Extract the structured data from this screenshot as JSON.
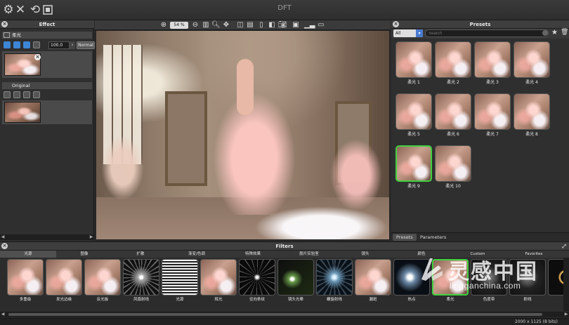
{
  "window": {
    "title": "DFT"
  },
  "toolbar": {
    "icons": [
      "gear-icon",
      "close-x-icon",
      "refresh-icon",
      "fit-screen-icon"
    ]
  },
  "effect_panel": {
    "title": "Effect",
    "layer_section": {
      "name": "柔光",
      "opacity_value": "100.0",
      "blend_mode": "Normal"
    },
    "original_section": {
      "name": "Original"
    }
  },
  "canvas": {
    "zoom_value": "54 %"
  },
  "presets_panel": {
    "title": "Presets",
    "category": "All",
    "search_placeholder": "Search",
    "items": [
      {
        "label": "柔光 1",
        "selected": false
      },
      {
        "label": "柔光 2",
        "selected": false
      },
      {
        "label": "柔光 3",
        "selected": false
      },
      {
        "label": "柔光 4",
        "selected": false
      },
      {
        "label": "柔光 5",
        "selected": false
      },
      {
        "label": "柔光 6",
        "selected": false
      },
      {
        "label": "柔光 7",
        "selected": false
      },
      {
        "label": "柔光 8",
        "selected": false
      },
      {
        "label": "柔光 9",
        "selected": true
      },
      {
        "label": "柔光 10",
        "selected": false
      }
    ],
    "tabs": [
      {
        "label": "Presets",
        "active": true
      },
      {
        "label": "Parameters",
        "active": false
      }
    ]
  },
  "filters_panel": {
    "title": "Filters",
    "categories": [
      {
        "label": "光源",
        "active": true
      },
      {
        "label": "图像",
        "active": false
      },
      {
        "label": "扩散",
        "active": false
      },
      {
        "label": "渐变/色调",
        "active": false
      },
      {
        "label": "特殊效果",
        "active": false
      },
      {
        "label": "胶片实验室",
        "active": false
      },
      {
        "label": "镜头",
        "active": false
      },
      {
        "label": "颜色",
        "active": false
      },
      {
        "label": "Custom",
        "active": false
      },
      {
        "label": "Favorites",
        "active": false
      }
    ],
    "items": [
      {
        "label": "多重级",
        "style": "photo"
      },
      {
        "label": "发光边缘",
        "style": "photo"
      },
      {
        "label": "反光板",
        "style": "photo"
      },
      {
        "label": "风扇射线",
        "style": "burst"
      },
      {
        "label": "光源",
        "style": "lines"
      },
      {
        "label": "辉光",
        "style": "photo"
      },
      {
        "label": "径向条纹",
        "style": "radial"
      },
      {
        "label": "镜头光晕",
        "style": "flare"
      },
      {
        "label": "螺旋射线",
        "style": "swirl"
      },
      {
        "label": "漏斑",
        "style": "photo"
      },
      {
        "label": "热点",
        "style": "hot"
      },
      {
        "label": "柔光",
        "style": "photo-selected"
      },
      {
        "label": "色度带",
        "style": "dark"
      },
      {
        "label": "射线",
        "style": "dark"
      },
      {
        "label": "",
        "style": "ring"
      }
    ]
  },
  "status": {
    "text": "2000 x 1125 (8 bits)"
  },
  "watermark": {
    "text": "灵感中国",
    "url": "lingganchina.com"
  }
}
